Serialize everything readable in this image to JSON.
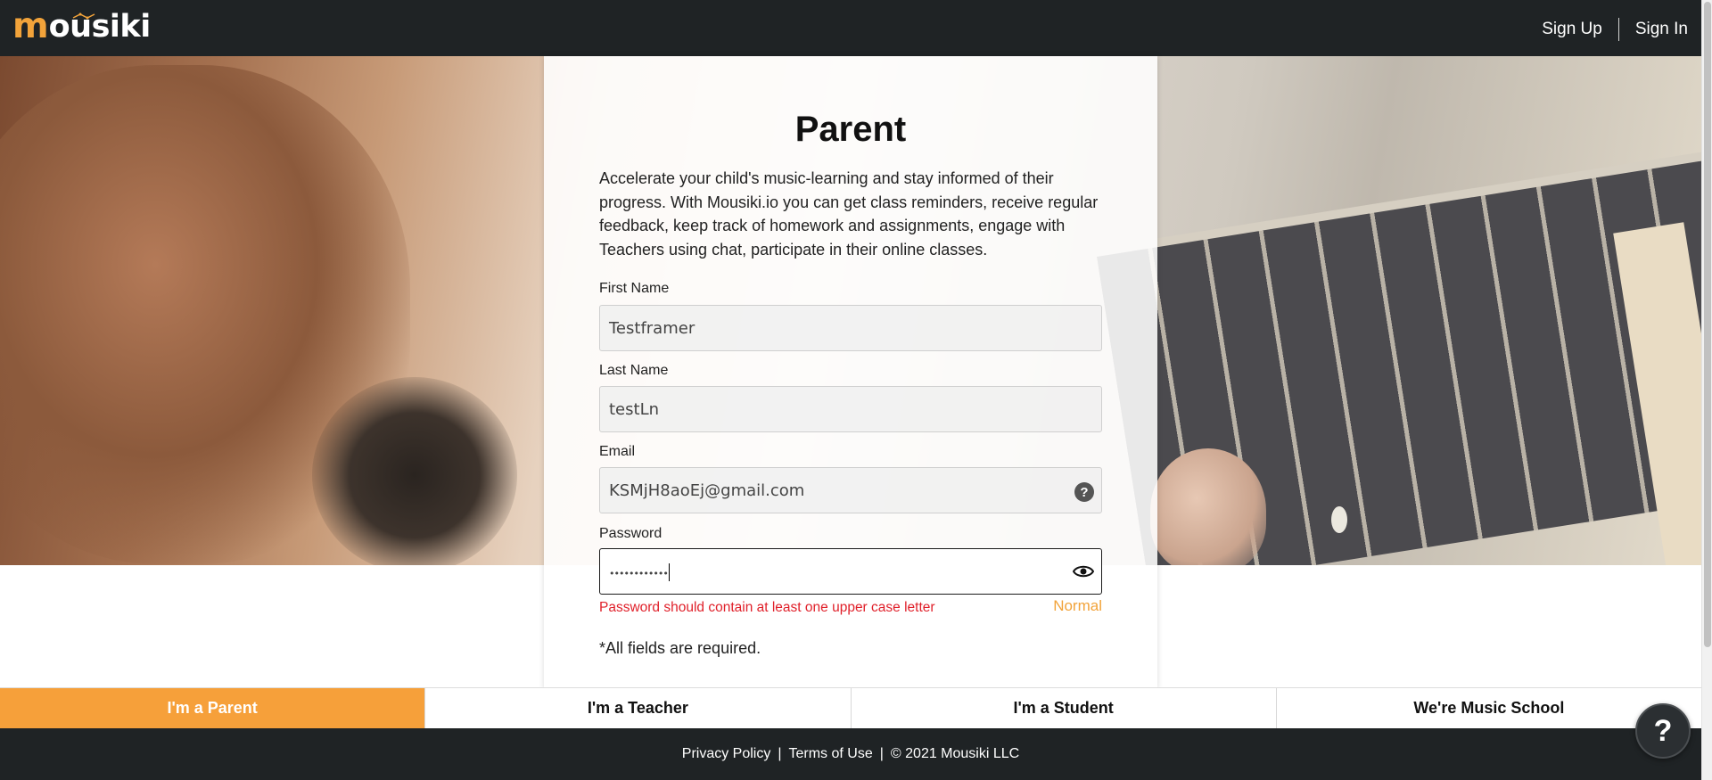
{
  "header": {
    "logo_first": "m",
    "logo_rest": "ousiki",
    "signup_label": "Sign Up",
    "signin_label": "Sign In"
  },
  "card": {
    "title": "Parent",
    "description": "Accelerate your child's music-learning and stay informed of their progress. With Mousiki.io you can get class reminders, receive regular feedback, keep track of homework and assignments, engage with Teachers using chat, participate in their online classes.",
    "first_name": {
      "label": "First Name",
      "value": "Testframer"
    },
    "last_name": {
      "label": "Last Name",
      "value": "testLn"
    },
    "email": {
      "label": "Email",
      "value": "KSMjH8aoEj@gmail.com",
      "help_glyph": "?"
    },
    "password": {
      "label": "Password",
      "value": "••••••••••••"
    },
    "password_error": "Password should contain at least one upper case letter",
    "password_strength": "Normal",
    "required_note": "*All fields are required."
  },
  "tabs": [
    {
      "label": "I'm a Parent",
      "active": true
    },
    {
      "label": "I'm a Teacher",
      "active": false
    },
    {
      "label": "I'm a Student",
      "active": false
    },
    {
      "label": "We're Music School",
      "active": false
    }
  ],
  "footer": {
    "privacy": "Privacy Policy",
    "terms": "Terms of Use",
    "copyright": "© 2021 Mousiki LLC",
    "separator": "|"
  },
  "help_bubble": "?",
  "colors": {
    "accent": "#f6a03a",
    "dark_bar": "#1f2325",
    "error": "#e0202a",
    "strength": "#f2a33a"
  },
  "icons": [
    "music-notes-icon",
    "help-icon",
    "eye-icon",
    "help-bubble-icon"
  ]
}
